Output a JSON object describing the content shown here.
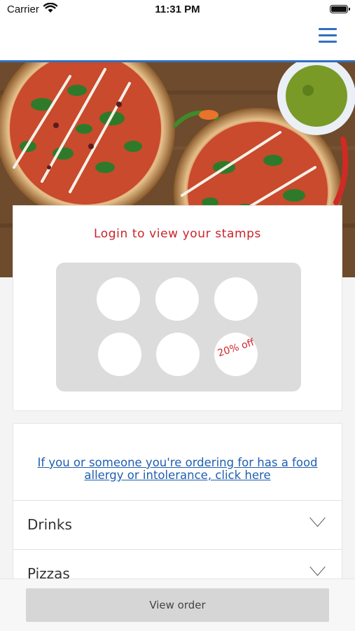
{
  "status_bar": {
    "carrier": "Carrier",
    "time": "11:31 PM"
  },
  "header": {
    "menu_icon": "hamburger-menu-icon",
    "accent_color": "#2f6fc0"
  },
  "hero": {
    "image": "pizzas-on-wooden-table"
  },
  "stamps": {
    "title": "Login to view your stamps",
    "reward_label": "20% off",
    "title_color": "#c8242b"
  },
  "info": {
    "allergy_link": "If you or someone you're ordering for has a food allergy or intolerance, click here"
  },
  "menu": {
    "categories": [
      {
        "label": "Drinks"
      },
      {
        "label": "Pizzas"
      }
    ]
  },
  "footer": {
    "view_order_label": "View order"
  }
}
